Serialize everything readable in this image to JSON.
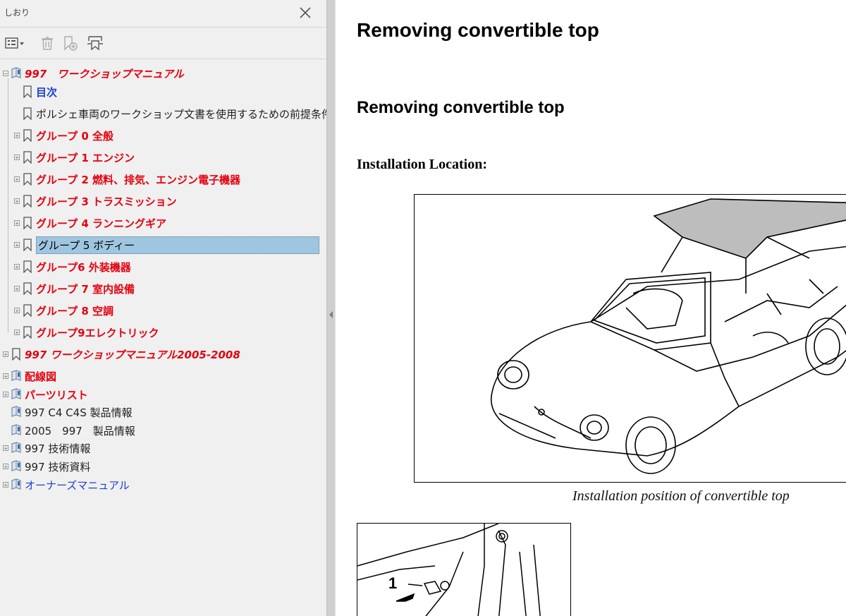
{
  "sidebar": {
    "title": "しおり",
    "toolbar": {
      "options_icon": "list-options-icon",
      "delete_icon": "trash-icon",
      "new_bookmark_icon": "new-bookmark-icon",
      "expand_icon": "expand-bookmark-icon"
    },
    "tree": [
      {
        "label": "997　ワークショップマニュアル",
        "style": "red-it",
        "icon": "book-bookmark-icon",
        "expander": "−",
        "level": 0
      },
      {
        "label": "目次",
        "style": "blue-b",
        "icon": "bookmark-icon",
        "expander": "",
        "level": 1
      },
      {
        "label": "ポルシェ車両のワークショップ文書を使用するための前提条件",
        "style": "plain",
        "icon": "bookmark-icon",
        "expander": "",
        "level": 1
      },
      {
        "label": "グループ 0 全般",
        "style": "red",
        "icon": "bookmark-icon",
        "expander": "+",
        "level": 1
      },
      {
        "label": "グループ 1 エンジン",
        "style": "red",
        "icon": "bookmark-icon",
        "expander": "+",
        "level": 1
      },
      {
        "label": "グループ 2 燃料、排気、エンジン電子機器",
        "style": "red",
        "icon": "bookmark-icon",
        "expander": "+",
        "level": 1
      },
      {
        "label": "グループ 3 トラスミッション",
        "style": "red",
        "icon": "bookmark-icon",
        "expander": "+",
        "level": 1
      },
      {
        "label": "グループ 4 ランニングギア",
        "style": "red",
        "icon": "bookmark-icon",
        "expander": "+",
        "level": 1
      },
      {
        "label": "グループ 5 ボディー",
        "style": "sel",
        "icon": "bookmark-icon",
        "expander": "+",
        "level": 1
      },
      {
        "label": "グループ6 外装機器",
        "style": "red",
        "icon": "bookmark-icon",
        "expander": "+",
        "level": 1
      },
      {
        "label": "グループ 7 室内設備",
        "style": "red",
        "icon": "bookmark-icon",
        "expander": "+",
        "level": 1
      },
      {
        "label": "グループ 8 空調",
        "style": "red",
        "icon": "bookmark-icon",
        "expander": "+",
        "level": 1
      },
      {
        "label": "グループ9エレクトリック",
        "style": "red",
        "icon": "bookmark-icon",
        "expander": "+",
        "level": 1
      },
      {
        "label": "997 ワークショップマニュアル2005-2008",
        "style": "red-it",
        "icon": "bookmark-icon",
        "expander": "+",
        "level": 0
      },
      {
        "label": "配線図",
        "style": "red",
        "icon": "book-bookmark-icon",
        "expander": "+",
        "level": 0
      },
      {
        "label": "パーツリスト",
        "style": "red",
        "icon": "book-bookmark-icon",
        "expander": "+",
        "level": 0
      },
      {
        "label": "997 C4 C4S 製品情報",
        "style": "plain",
        "icon": "book-bookmark-icon",
        "expander": "",
        "level": 0
      },
      {
        "label": "2005　997　製品情報",
        "style": "plain",
        "icon": "book-bookmark-icon",
        "expander": "",
        "level": 0
      },
      {
        "label": "997 技術情報",
        "style": "plain",
        "icon": "book-bookmark-icon",
        "expander": "+",
        "level": 0
      },
      {
        "label": "997 技術資料",
        "style": "plain",
        "icon": "book-bookmark-icon",
        "expander": "+",
        "level": 0
      },
      {
        "label": "オーナーズマニュアル",
        "style": "blue",
        "icon": "book-bookmark-icon",
        "expander": "+",
        "level": 0
      }
    ]
  },
  "document": {
    "heading1": "Removing convertible top",
    "heading2": "Removing convertible top",
    "section_label": "Installation Location:",
    "figure1_caption": "Installation position of convertible top",
    "figure2_callout": "1"
  }
}
